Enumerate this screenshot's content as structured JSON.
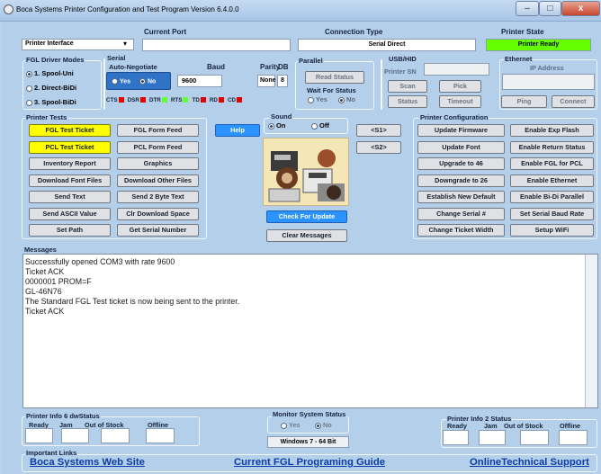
{
  "window": {
    "title": "Boca Systems Printer Configuration and Test Program  Version 6.4.0.0",
    "min": "–",
    "max": "□",
    "close": "x"
  },
  "top": {
    "current_port_label": "Current Port",
    "connection_type_label": "Connection Type",
    "printer_state_label": "Printer State",
    "interface_select": "Printer Interface",
    "connection_type": "Serial Direct",
    "printer_state": "Printer Ready"
  },
  "fgl": {
    "title": "FGL Driver Modes",
    "modes": [
      "1. Spool-Uni",
      "2. Direct-BiDi",
      "3. Spool-BiDi"
    ]
  },
  "serial": {
    "title": "Serial",
    "autoneg_title": "Auto-Negotiate",
    "yes": "Yes",
    "no": "No",
    "baud_label": "Baud",
    "baud": "9600",
    "parity_label": "Parity",
    "parity": "None",
    "db_label": "DB",
    "db": "8",
    "signals": [
      "CTS",
      "DSR",
      "DTR",
      "RTS",
      "TD",
      "RD",
      "CD"
    ]
  },
  "parallel": {
    "title": "Parallel",
    "read_status": "Read Status",
    "wait_title": "Wait For Status",
    "yes": "Yes",
    "no": "No"
  },
  "usb": {
    "title": "USB/HID",
    "sn_label": "Printer SN",
    "scan": "Scan",
    "pick": "Pick",
    "status": "Status",
    "timeout": "Timeout"
  },
  "ethernet": {
    "title": "Ethernet",
    "ip_label": "IP Address",
    "ping": "Ping",
    "connect": "Connect"
  },
  "tests": {
    "title": "Printer Tests",
    "buttons": [
      "FGL Test Ticket",
      "FGL Form Feed",
      "PCL Test Ticket",
      "PCL Form Feed",
      "Inventory Report",
      "Graphics",
      "Download Font Files",
      "Download Other Files",
      "Send Text",
      "Send 2 Byte Text",
      "Send ASCII Value",
      "Clr Download Space",
      "Set Path",
      "Get Serial Number"
    ]
  },
  "help": "Help",
  "sound": {
    "title": "Sound",
    "on": "On",
    "off": "Off"
  },
  "s1": "<S1>",
  "s2": "<S2>",
  "check_update": "Check For Update",
  "clear_messages": "Clear Messages",
  "config": {
    "title": "Printer Configuration",
    "buttons": [
      "Update Firmware",
      "Enable Exp Flash",
      "Update Font",
      "Enable Return Status",
      "Upgrade to 46",
      "Enable FGL for PCL",
      "Downgrade to 26",
      "Enable Ethernet",
      "Establish New Default",
      "Enable Bi-Di Parallel",
      "Change Serial #",
      "Set Serial Baud Rate",
      "Change Ticket Width",
      "Setup WiFi"
    ]
  },
  "messages": {
    "title": "Messages",
    "lines": [
      "Successfully opened COM3 with rate 9600",
      "Ticket ACK",
      "0000001 PROM=F",
      "GL-46N76",
      "The Standard FGL Test ticket is now being sent to the printer.",
      "Ticket ACK"
    ]
  },
  "info6": {
    "title": "Printer Info 6 dwStatus",
    "cols": [
      "Ready",
      "Jam",
      "Out of Stock",
      "Offline"
    ]
  },
  "monitor": {
    "title": "Monitor System Status",
    "yes": "Yes",
    "no": "No",
    "os": "Windows 7 - 64 Bit"
  },
  "info2": {
    "title": "Printer Info 2 Status",
    "cols": [
      "Ready",
      "Jam",
      "Out of Stock",
      "Offline"
    ]
  },
  "links": {
    "title": "Important Links",
    "boca": "Boca Systems Web Site",
    "fgl_guide": "Current FGL Programing Guide",
    "support": "OnlineTechnical Support"
  },
  "colors": {
    "accent": "#2a93ff",
    "ready": "#66ff00",
    "yellow": "#ffff00",
    "led_red": "#e30000",
    "led_green": "#66ff33"
  }
}
